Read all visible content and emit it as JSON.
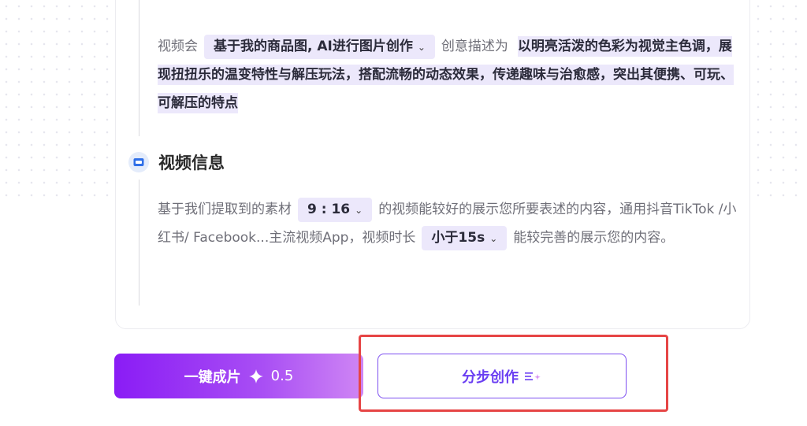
{
  "video_content": {
    "prefix": "视频会",
    "mode_chip": "基于我的商品图, AI进行图片创作",
    "desc_label": "创意描述为",
    "description": "以明亮活泼的色彩为视觉主色调，展现扭扭乐的温变特性与解压玩法，搭配流畅的动态效果，传递趣味与治愈感，突出其便携、可玩、可解压的特点"
  },
  "video_info": {
    "title": "视频信息",
    "text_1": "基于我们提取到的素材",
    "ratio_chip": "9 : 16",
    "text_2": "的视频能较好的展示您所要表述的内容，通用抖音TikTok /小红书/ Facebook...主流视频App，视频时长",
    "duration_chip": "小于15s",
    "text_3": "能较完善的展示您的内容。"
  },
  "actions": {
    "one_click_label": "一键成片",
    "one_click_cost": "0.5",
    "step_label": "分步创作"
  },
  "colors": {
    "accent": "#7d4ff0",
    "chip_bg": "#ece8fb",
    "annotation_red": "#e64545",
    "primary_gradient_start": "#8a1cf5",
    "primary_gradient_end": "#cf86f4"
  },
  "icons": {
    "section_icon": "video-icon",
    "chip_caret": "chevron-down-icon",
    "cost_icon": "sparkle-icon",
    "step_icon": "list-sparkle-icon"
  }
}
